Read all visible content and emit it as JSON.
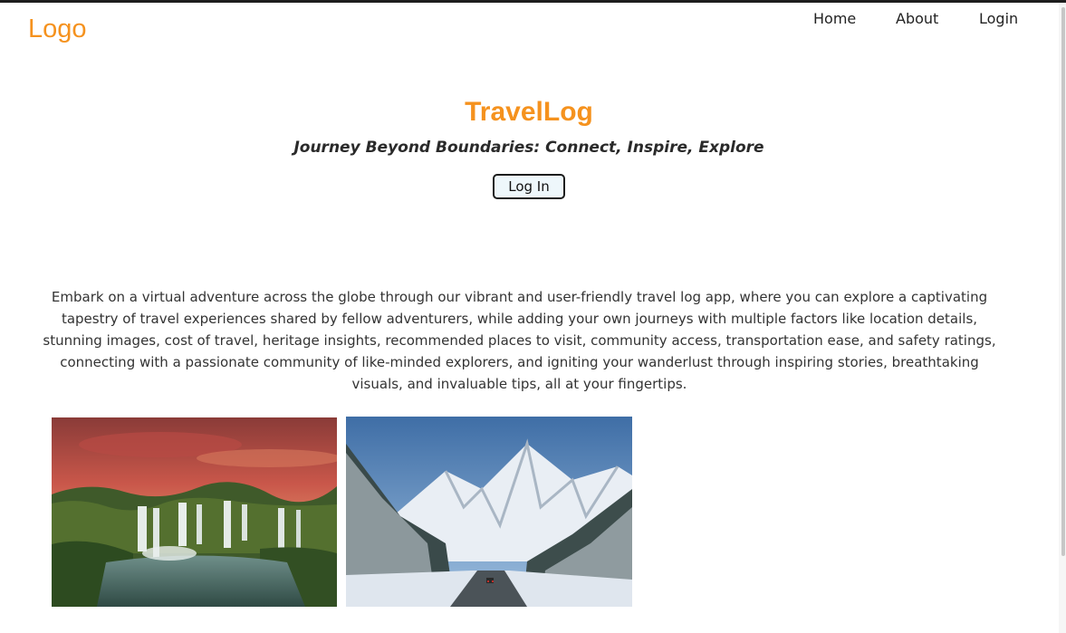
{
  "header": {
    "logo": "Logo",
    "nav": [
      {
        "label": "Home"
      },
      {
        "label": "About"
      },
      {
        "label": "Login"
      }
    ]
  },
  "hero": {
    "title": "TravelLog",
    "subtitle": "Journey Beyond Boundaries: Connect, Inspire, Explore",
    "button_label": "Log In"
  },
  "intro": {
    "text": "Embark on a virtual adventure across the globe through our vibrant and user-friendly travel log app, where you can explore a captivating tapestry of travel experiences shared by fellow adventurers, while adding your own journeys with multiple factors like location details, stunning images, cost of travel, heritage insights, recommended places to visit, community access, transportation ease, and safety ratings, connecting with a passionate community of like-minded explorers, and igniting your wanderlust through inspiring stories, breathtaking visuals, and invaluable tips, all at your fingertips."
  },
  "gallery": [
    {
      "name": "waterfall-photo"
    },
    {
      "name": "snowy-mountain-road-photo"
    }
  ],
  "colors": {
    "accent": "#f5921e",
    "text": "#222222",
    "button_bg": "#eef7fb"
  }
}
